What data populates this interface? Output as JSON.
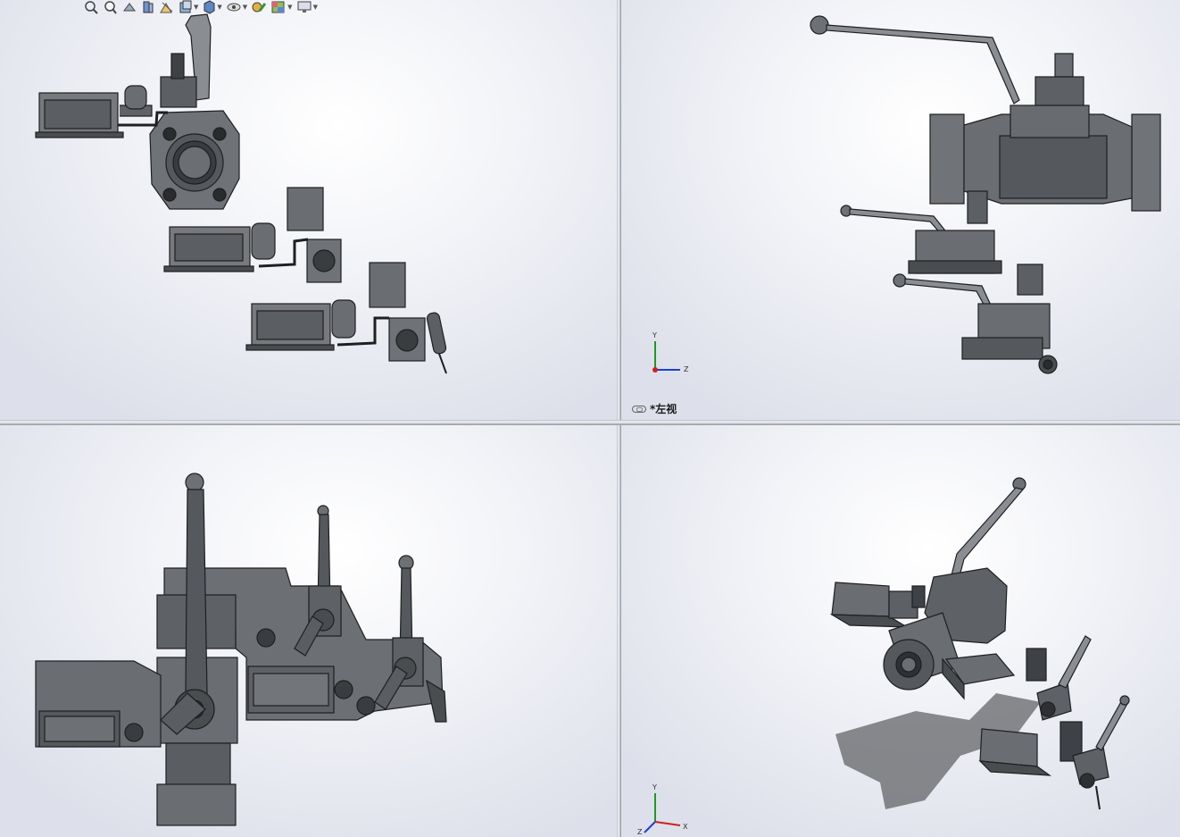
{
  "toolbar": {
    "items": [
      {
        "icon": "zoom-to-fit-icon"
      },
      {
        "icon": "zoom-to-area-icon"
      },
      {
        "icon": "previous-view-icon"
      },
      {
        "icon": "section-view-icon"
      },
      {
        "icon": "dynamic-annotation-icon"
      },
      {
        "icon": "view-orientation-icon"
      },
      {
        "icon": "display-style-icon"
      },
      {
        "icon": "hide-show-items-icon"
      },
      {
        "icon": "edit-appearance-icon"
      },
      {
        "icon": "apply-scene-icon"
      },
      {
        "icon": "view-settings-icon"
      }
    ]
  },
  "viewports": {
    "top_left": {
      "name": "top-view"
    },
    "top_right": {
      "name": "left-view",
      "label": "*左视"
    },
    "bottom_left": {
      "name": "front-view"
    },
    "bottom_right": {
      "name": "isometric-view"
    }
  },
  "triad": {
    "x": "X",
    "y": "Y",
    "z": "Z"
  },
  "colors": {
    "part_fill": "#6b6e72",
    "part_dark": "#3e4145",
    "part_light": "#9a9ea3",
    "edge": "#1e1f21",
    "axis_x": "#d11f1f",
    "axis_y": "#1c9a22",
    "axis_z": "#1f3fd1"
  }
}
